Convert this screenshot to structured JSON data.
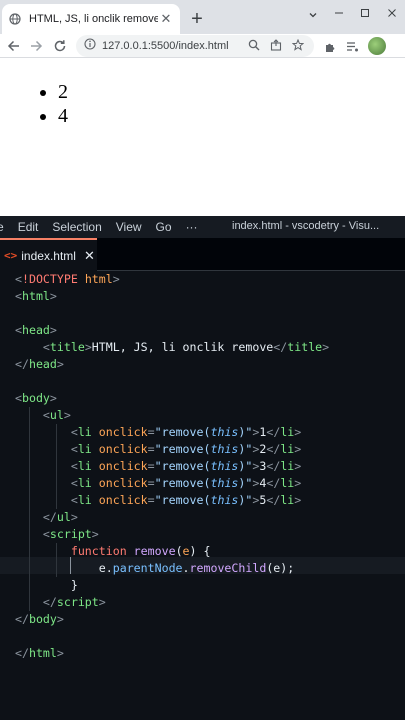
{
  "browser": {
    "tab_title": "HTML, JS, li onclik remove",
    "tab_close": "✕",
    "new_tab": "+",
    "url": "127.0.0.1:5500/index.html",
    "page_list": [
      "2",
      "4"
    ]
  },
  "vscode": {
    "menu": [
      "e",
      "Edit",
      "Selection",
      "View",
      "Go",
      "···"
    ],
    "window_title": "index.html - vscodetry - Visu...",
    "tab": {
      "icon": "<>",
      "name": "index.html",
      "close": "✕"
    }
  },
  "code": [
    {
      "tokens": [
        [
          "k-punc",
          "<"
        ],
        [
          "k-doc",
          "!DOCTYPE"
        ],
        [
          "k-txt",
          " "
        ],
        [
          "k-orange",
          "html"
        ],
        [
          "k-punc",
          ">"
        ]
      ]
    },
    {
      "tokens": [
        [
          "k-punc",
          "<"
        ],
        [
          "k-tag",
          "html"
        ],
        [
          "k-punc",
          ">"
        ]
      ]
    },
    {
      "tokens": []
    },
    {
      "tokens": [
        [
          "k-punc",
          "<"
        ],
        [
          "k-tag",
          "head"
        ],
        [
          "k-punc",
          ">"
        ]
      ]
    },
    {
      "tokens": [
        [
          "k-txt",
          "    "
        ],
        [
          "k-punc",
          "<"
        ],
        [
          "k-tag",
          "title"
        ],
        [
          "k-punc",
          ">"
        ],
        [
          "k-txt",
          "HTML, JS, li onclik remove"
        ],
        [
          "k-punc",
          "</"
        ],
        [
          "k-tag",
          "title"
        ],
        [
          "k-punc",
          ">"
        ]
      ]
    },
    {
      "tokens": [
        [
          "k-punc",
          "</"
        ],
        [
          "k-tag",
          "head"
        ],
        [
          "k-punc",
          ">"
        ]
      ]
    },
    {
      "tokens": []
    },
    {
      "tokens": [
        [
          "k-punc",
          "<"
        ],
        [
          "k-tag",
          "body"
        ],
        [
          "k-punc",
          ">"
        ]
      ]
    },
    {
      "tokens": [
        [
          "k-txt",
          "    "
        ],
        [
          "k-punc",
          "<"
        ],
        [
          "k-tag",
          "ul"
        ],
        [
          "k-punc",
          ">"
        ]
      ]
    },
    {
      "tokens": [
        [
          "k-txt",
          "        "
        ],
        [
          "k-punc",
          "<"
        ],
        [
          "k-tag",
          "li"
        ],
        [
          "k-txt",
          " "
        ],
        [
          "k-orange",
          "onclick"
        ],
        [
          "k-punc",
          "="
        ],
        [
          "k-str",
          "\"remove("
        ],
        [
          "k-this",
          "this"
        ],
        [
          "k-str",
          ")\""
        ],
        [
          "k-punc",
          ">"
        ],
        [
          "k-txt",
          "1"
        ],
        [
          "k-punc",
          "</"
        ],
        [
          "k-tag",
          "li"
        ],
        [
          "k-punc",
          ">"
        ]
      ]
    },
    {
      "tokens": [
        [
          "k-txt",
          "        "
        ],
        [
          "k-punc",
          "<"
        ],
        [
          "k-tag",
          "li"
        ],
        [
          "k-txt",
          " "
        ],
        [
          "k-orange",
          "onclick"
        ],
        [
          "k-punc",
          "="
        ],
        [
          "k-str",
          "\"remove("
        ],
        [
          "k-this",
          "this"
        ],
        [
          "k-str",
          ")\""
        ],
        [
          "k-punc",
          ">"
        ],
        [
          "k-txt",
          "2"
        ],
        [
          "k-punc",
          "</"
        ],
        [
          "k-tag",
          "li"
        ],
        [
          "k-punc",
          ">"
        ]
      ]
    },
    {
      "tokens": [
        [
          "k-txt",
          "        "
        ],
        [
          "k-punc",
          "<"
        ],
        [
          "k-tag",
          "li"
        ],
        [
          "k-txt",
          " "
        ],
        [
          "k-orange",
          "onclick"
        ],
        [
          "k-punc",
          "="
        ],
        [
          "k-str",
          "\"remove("
        ],
        [
          "k-this",
          "this"
        ],
        [
          "k-str",
          ")\""
        ],
        [
          "k-punc",
          ">"
        ],
        [
          "k-txt",
          "3"
        ],
        [
          "k-punc",
          "</"
        ],
        [
          "k-tag",
          "li"
        ],
        [
          "k-punc",
          ">"
        ]
      ]
    },
    {
      "tokens": [
        [
          "k-txt",
          "        "
        ],
        [
          "k-punc",
          "<"
        ],
        [
          "k-tag",
          "li"
        ],
        [
          "k-txt",
          " "
        ],
        [
          "k-orange",
          "onclick"
        ],
        [
          "k-punc",
          "="
        ],
        [
          "k-str",
          "\"remove("
        ],
        [
          "k-this",
          "this"
        ],
        [
          "k-str",
          ")\""
        ],
        [
          "k-punc",
          ">"
        ],
        [
          "k-txt",
          "4"
        ],
        [
          "k-punc",
          "</"
        ],
        [
          "k-tag",
          "li"
        ],
        [
          "k-punc",
          ">"
        ]
      ]
    },
    {
      "tokens": [
        [
          "k-txt",
          "        "
        ],
        [
          "k-punc",
          "<"
        ],
        [
          "k-tag",
          "li"
        ],
        [
          "k-txt",
          " "
        ],
        [
          "k-orange",
          "onclick"
        ],
        [
          "k-punc",
          "="
        ],
        [
          "k-str",
          "\"remove("
        ],
        [
          "k-this",
          "this"
        ],
        [
          "k-str",
          ")\""
        ],
        [
          "k-punc",
          ">"
        ],
        [
          "k-txt",
          "5"
        ],
        [
          "k-punc",
          "</"
        ],
        [
          "k-tag",
          "li"
        ],
        [
          "k-punc",
          ">"
        ]
      ]
    },
    {
      "tokens": [
        [
          "k-txt",
          "    "
        ],
        [
          "k-punc",
          "</"
        ],
        [
          "k-tag",
          "ul"
        ],
        [
          "k-punc",
          ">"
        ]
      ]
    },
    {
      "tokens": [
        [
          "k-txt",
          "    "
        ],
        [
          "k-punc",
          "<"
        ],
        [
          "k-tag",
          "script"
        ],
        [
          "k-punc",
          ">"
        ]
      ]
    },
    {
      "tokens": [
        [
          "k-txt",
          "        "
        ],
        [
          "k-kw",
          "function"
        ],
        [
          "k-txt",
          " "
        ],
        [
          "k-fn",
          "remove"
        ],
        [
          "k-txt",
          "("
        ],
        [
          "k-orange",
          "e"
        ],
        [
          "k-txt",
          ") {"
        ]
      ]
    },
    {
      "tokens": [
        [
          "k-txt",
          "            e."
        ],
        [
          "k-attr",
          "parentNode"
        ],
        [
          "k-txt",
          "."
        ],
        [
          "k-fn",
          "removeChild"
        ],
        [
          "k-txt",
          "(e);"
        ]
      ]
    },
    {
      "tokens": [
        [
          "k-txt",
          "        }"
        ]
      ]
    },
    {
      "tokens": [
        [
          "k-txt",
          "    "
        ],
        [
          "k-punc",
          "</"
        ],
        [
          "k-tag",
          "script"
        ],
        [
          "k-punc",
          ">"
        ]
      ]
    },
    {
      "tokens": [
        [
          "k-punc",
          "</"
        ],
        [
          "k-tag",
          "body"
        ],
        [
          "k-punc",
          ">"
        ]
      ]
    },
    {
      "tokens": []
    },
    {
      "tokens": [
        [
          "k-punc",
          "</"
        ],
        [
          "k-tag",
          "html"
        ],
        [
          "k-punc",
          ">"
        ]
      ]
    }
  ],
  "colors": {
    "editor_bg": "#0d1117",
    "tag": "#7ee787",
    "attr": "#ffa657",
    "string": "#a5d6ff",
    "keyword": "#ff7b72",
    "function": "#d2a8ff"
  }
}
